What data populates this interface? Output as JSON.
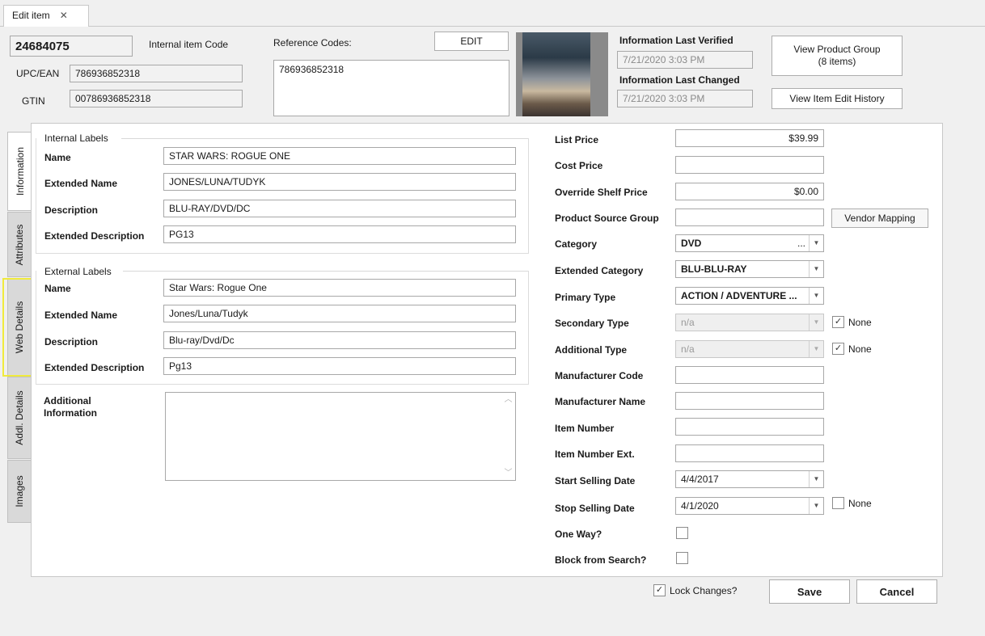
{
  "window": {
    "tab_label": "Edit item",
    "tab_close_icon": "close-icon"
  },
  "header": {
    "item_code": "24684075",
    "item_code_label": "Internal item Code",
    "upc_label": "UPC/EAN",
    "upc_value": "786936852318",
    "gtin_label": "GTIN",
    "gtin_value": "00786936852318",
    "reference_codes_label": "Reference Codes:",
    "edit_button": "EDIT",
    "reference_codes_list": [
      "786936852318"
    ],
    "last_verified_label": "Information Last Verified",
    "last_verified_value": "7/21/2020 3:03 PM",
    "last_changed_label": "Information Last Changed",
    "last_changed_value": "7/21/2020 3:03 PM",
    "view_product_group_line1": "View Product Group",
    "view_product_group_line2": "(8 items)",
    "view_edit_history": "View Item Edit History"
  },
  "side_tabs": [
    {
      "label": "Information",
      "active": true
    },
    {
      "label": "Attributes",
      "active": false
    },
    {
      "label": "Web Details",
      "active": false,
      "highlighted": true
    },
    {
      "label": "Addl. Details",
      "active": false
    },
    {
      "label": "Images",
      "active": false
    }
  ],
  "internal_labels": {
    "group_title": "Internal Labels",
    "name_label": "Name",
    "name_value": "STAR WARS: ROGUE ONE",
    "ext_name_label": "Extended Name",
    "ext_name_value": "JONES/LUNA/TUDYK",
    "desc_label": "Description",
    "desc_value": "BLU-RAY/DVD/DC",
    "ext_desc_label": "Extended Description",
    "ext_desc_value": "PG13"
  },
  "external_labels": {
    "group_title": "External Labels",
    "name_label": "Name",
    "name_value": "Star Wars: Rogue One",
    "ext_name_label": "Extended Name",
    "ext_name_value": "Jones/Luna/Tudyk",
    "desc_label": "Description",
    "desc_value": "Blu-ray/Dvd/Dc",
    "ext_desc_label": "Extended Description",
    "ext_desc_value": "Pg13"
  },
  "additional_info": {
    "label_line1": "Additional",
    "label_line2": "Information",
    "value": ""
  },
  "right_form": {
    "list_price_label": "List Price",
    "list_price_value": "$39.99",
    "cost_price_label": "Cost Price",
    "cost_price_value": "",
    "override_shelf_label": "Override Shelf Price",
    "override_shelf_value": "$0.00",
    "product_source_label": "Product Source Group",
    "product_source_value": "",
    "vendor_mapping_button": "Vendor Mapping",
    "category_label": "Category",
    "category_value": "DVD",
    "category_dots": "...",
    "ext_category_label": "Extended Category",
    "ext_category_value": "BLU-BLU-RAY",
    "primary_type_label": "Primary Type",
    "primary_type_value": "ACTION / ADVENTURE ...",
    "secondary_type_label": "Secondary Type",
    "secondary_type_value": "n/a",
    "secondary_none_label": "None",
    "additional_type_label": "Additional Type",
    "additional_type_value": "n/a",
    "additional_none_label": "None",
    "mfr_code_label": "Manufacturer Code",
    "mfr_code_value": "",
    "mfr_name_label": "Manufacturer Name",
    "mfr_name_value": "",
    "item_number_label": "Item Number",
    "item_number_value": "",
    "item_number_ext_label": "Item Number Ext.",
    "item_number_ext_value": "",
    "start_selling_label": "Start Selling Date",
    "start_selling_value": "4/4/2017",
    "stop_selling_label": "Stop Selling Date",
    "stop_selling_value": "4/1/2020",
    "stop_none_label": "None",
    "one_way_label": "One Way?",
    "block_search_label": "Block from Search?"
  },
  "footer": {
    "lock_changes_label": "Lock Changes?",
    "save_button": "Save",
    "cancel_button": "Cancel"
  },
  "checkmark_glyph": "✓",
  "dropdown_glyph": "▼",
  "close_glyph": "✕",
  "scroll_up_glyph": "︿",
  "scroll_down_glyph": "﹀"
}
